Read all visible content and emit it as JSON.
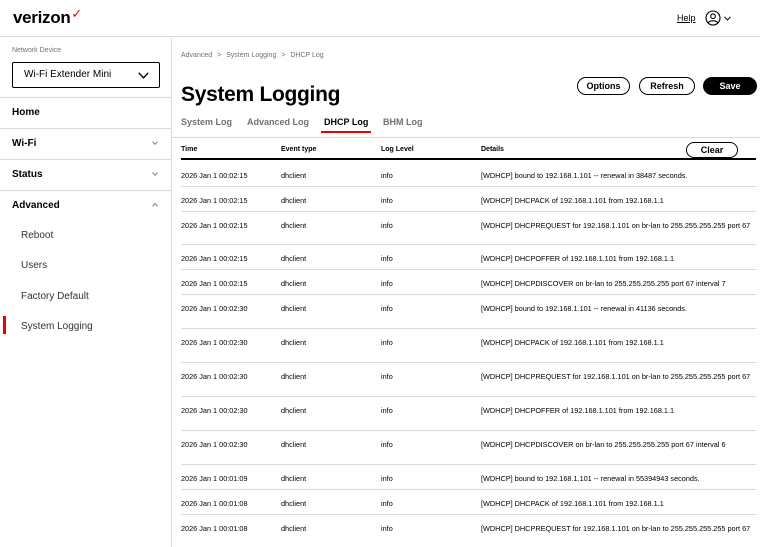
{
  "header": {
    "brand": "verizon",
    "brand_mark": "✓",
    "help_label": "Help",
    "user_icon": "user-circle-icon",
    "accent_color": "#ee0000"
  },
  "sidebar": {
    "device_label": "Network Device",
    "device_selected": "Wi-Fi Extender Mini",
    "items": [
      {
        "label": "Home",
        "bold": true,
        "chevron": ""
      },
      {
        "label": "Wi-Fi",
        "bold": true,
        "chevron": "down"
      },
      {
        "label": "Status",
        "bold": true,
        "chevron": "down"
      },
      {
        "label": "Advanced",
        "bold": true,
        "chevron": "up"
      },
      {
        "label": "Reboot",
        "bold": false,
        "chevron": ""
      },
      {
        "label": "Users",
        "bold": false,
        "chevron": ""
      },
      {
        "label": "Factory Default",
        "bold": false,
        "chevron": ""
      },
      {
        "label": "System Logging",
        "bold": false,
        "chevron": "",
        "active": true
      }
    ]
  },
  "main": {
    "breadcrumb": [
      "Advanced",
      ">",
      "System Logging",
      ">",
      "DHCP Log"
    ],
    "title": "System Logging",
    "buttons": {
      "options": "Options",
      "refresh": "Refresh",
      "save": "Save",
      "clear": "Clear"
    },
    "tabs": [
      {
        "label": "System Log",
        "active": false
      },
      {
        "label": "Advanced Log",
        "active": false
      },
      {
        "label": "DHCP Log",
        "active": true
      },
      {
        "label": "BHM Log",
        "active": false
      }
    ],
    "columns": [
      "Time",
      "Event type",
      "Log Level",
      "Details"
    ],
    "rows": [
      {
        "time": "2026 Jan 1 00:02:15",
        "event": "dhclient",
        "level": "info",
        "details": "[WDHCP] bound to 192.168.1.101 -- renewal in 38487 seconds."
      },
      {
        "time": "2026 Jan 1 00:02:15",
        "event": "dhclient",
        "level": "info",
        "details": "[WDHCP] DHCPACK of 192.168.1.101 from 192.168.1.1"
      },
      {
        "time": "2026 Jan 1 00:02:15",
        "event": "dhclient",
        "level": "info",
        "details": "[WDHCP] DHCPREQUEST for 192.168.1.101 on br-lan to 255.255.255.255 port 67"
      },
      {
        "time": "2026 Jan 1 00:02:15",
        "event": "dhclient",
        "level": "info",
        "details": "[WDHCP] DHCPOFFER of 192.168.1.101 from 192.168.1.1"
      },
      {
        "time": "2026 Jan 1 00:02:15",
        "event": "dhclient",
        "level": "info",
        "details": "[WDHCP] DHCPDISCOVER on br-lan to 255.255.255.255 port 67 interval 7"
      },
      {
        "time": "2026 Jan 1 00:02:30",
        "event": "dhclient",
        "level": "info",
        "details": "[WDHCP] bound to 192.168.1.101 -- renewal in 41136 seconds."
      },
      {
        "time": "2026 Jan 1 00:02:30",
        "event": "dhclient",
        "level": "info",
        "details": "[WDHCP] DHCPACK of 192.168.1.101 from 192.168.1.1"
      },
      {
        "time": "2026 Jan 1 00:02:30",
        "event": "dhclient",
        "level": "info",
        "details": "[WDHCP] DHCPREQUEST for 192.168.1.101 on br-lan to 255.255.255.255 port 67"
      },
      {
        "time": "2026 Jan 1 00:02:30",
        "event": "dhclient",
        "level": "info",
        "details": "[WDHCP] DHCPOFFER of 192.168.1.101 from 192.168.1.1"
      },
      {
        "time": "2026 Jan 1 00:02:30",
        "event": "dhclient",
        "level": "info",
        "details": "[WDHCP] DHCPDISCOVER on br-lan to 255.255.255.255 port 67 interval 6"
      },
      {
        "time": "2026 Jan 1 00:01:09",
        "event": "dhclient",
        "level": "info",
        "details": "[WDHCP] bound to 192.168.1.101 -- renewal in 55394943 seconds."
      },
      {
        "time": "2026 Jan 1 00:01:08",
        "event": "dhclient",
        "level": "info",
        "details": "[WDHCP] DHCPACK of 192.168.1.101 from 192.168.1.1"
      },
      {
        "time": "2026 Jan 1 00:01:08",
        "event": "dhclient",
        "level": "info",
        "details": "[WDHCP] DHCPREQUEST for 192.168.1.101 on br-lan to 255.255.255.255 port 67"
      }
    ]
  }
}
